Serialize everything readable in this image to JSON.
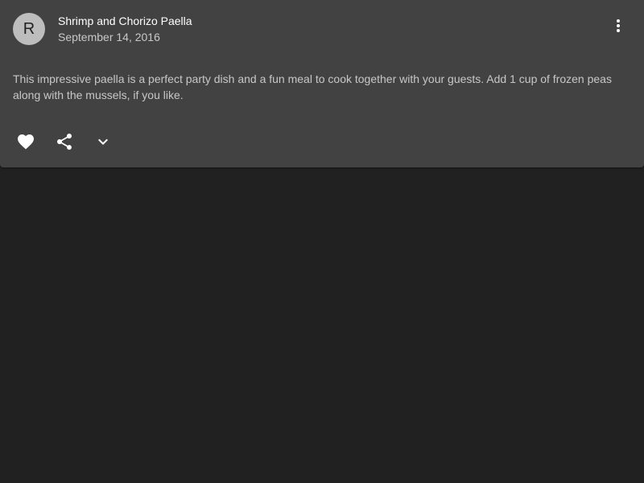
{
  "card": {
    "avatar_letter": "R",
    "title": "Shrimp and Chorizo Paella",
    "subheader": "September 14, 2016",
    "body": "This impressive paella is a perfect party dish and a fun meal to cook together with your guests. Add 1 cup of frozen peas along with the mussels, if you like.",
    "more_icon": "more-vert-icon",
    "actions": {
      "favorite_icon": "heart-icon",
      "share_icon": "share-icon",
      "expand_icon": "chevron-down-icon"
    }
  },
  "colors": {
    "background": "#212121",
    "card": "#424242",
    "avatar": "#bdbdbd",
    "icon": "#ffffff"
  }
}
